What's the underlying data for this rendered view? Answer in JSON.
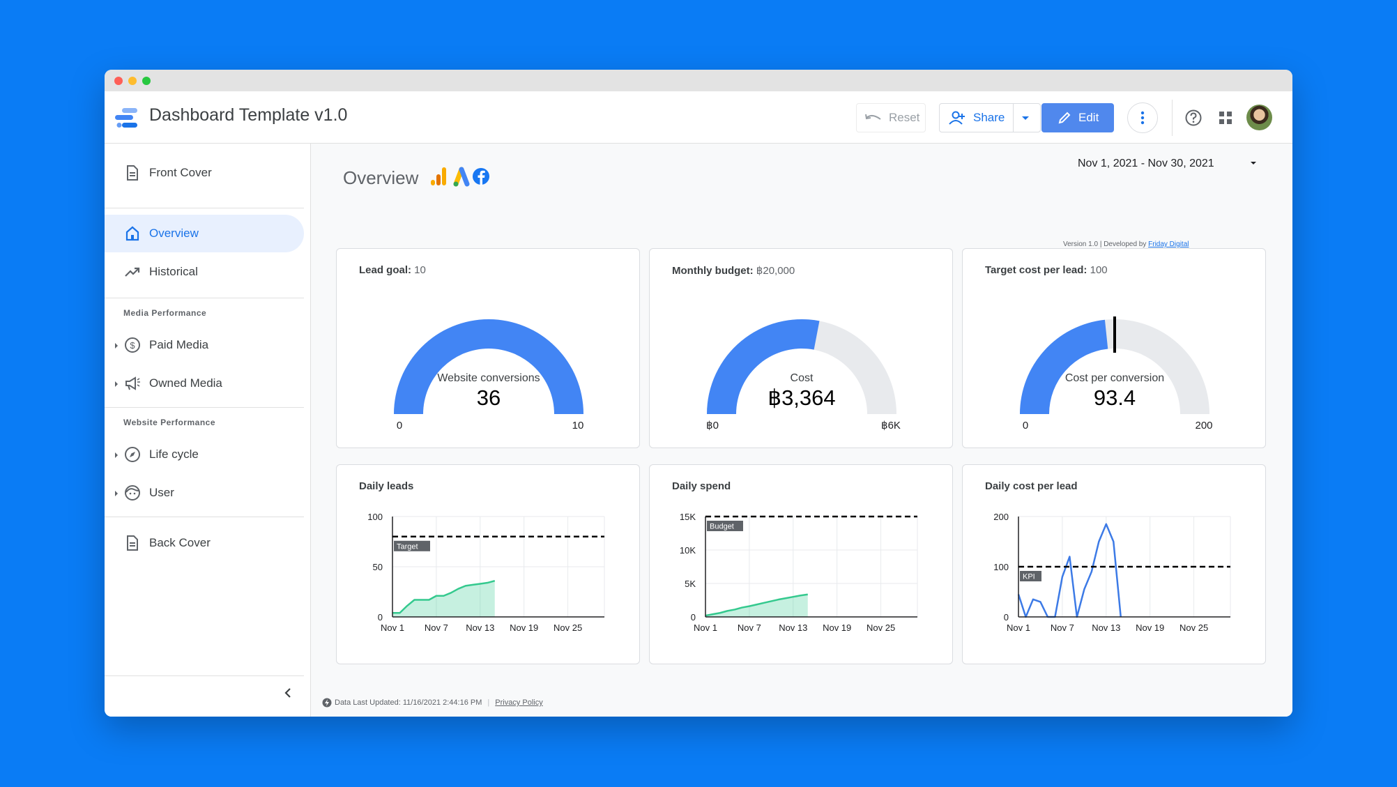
{
  "app": {
    "title": "Dashboard Template v1.0"
  },
  "toolbar": {
    "reset_label": "Reset",
    "share_label": "Share",
    "edit_label": "Edit"
  },
  "sidebar": {
    "front_cover": "Front Cover",
    "overview": "Overview",
    "historical": "Historical",
    "media_section": "Media Performance",
    "paid_media": "Paid Media",
    "owned_media": "Owned Media",
    "website_section": "Website Performance",
    "life_cycle": "Life cycle",
    "user": "User",
    "back_cover": "Back Cover"
  },
  "page": {
    "title": "Overview",
    "date_range": "Nov 1, 2021 - Nov 30, 2021",
    "version_text": "Version 1.0 | Developed by ",
    "version_link": "Friday Digital",
    "footer_updated": "Data Last Updated: 11/16/2021 2:44:16 PM",
    "footer_separator": "|",
    "footer_privacy": "Privacy Policy"
  },
  "gauges": [
    {
      "title_bold": "Lead goal:",
      "title_value": "10",
      "label": "Website conversions",
      "value": "36",
      "min_label": "0",
      "max_label": "10",
      "fill_fraction": 1.0,
      "target_fraction": null
    },
    {
      "title_bold": "Monthly budget:",
      "title_value": "฿20,000",
      "label": "Cost",
      "value": "฿3,364",
      "min_label": "฿0",
      "max_label": "฿6K",
      "fill_fraction": 0.56,
      "target_fraction": null
    },
    {
      "title_bold": "Target cost per lead:",
      "title_value": "100",
      "label": "Cost per conversion",
      "value": "93.4",
      "min_label": "0",
      "max_label": "200",
      "fill_fraction": 0.467,
      "target_fraction": 0.5
    }
  ],
  "chart_data": [
    {
      "type": "area",
      "title": "Daily leads",
      "ylim": [
        0,
        100
      ],
      "yticks": [
        "0",
        "50",
        "100"
      ],
      "xticks": [
        "Nov 1",
        "Nov 7",
        "Nov 13",
        "Nov 19",
        "Nov 25"
      ],
      "xtick_days": [
        1,
        7,
        13,
        19,
        25
      ],
      "xlim": [
        1,
        30
      ],
      "reference_line": {
        "label": "Target",
        "value": 80
      },
      "x": [
        1,
        2,
        3,
        4,
        5,
        6,
        7,
        8,
        9,
        10,
        11,
        12,
        13,
        14,
        15
      ],
      "values": [
        4,
        4,
        11,
        17,
        17,
        17,
        21,
        21,
        24,
        28,
        31,
        32,
        33,
        34,
        36
      ],
      "color": "#34c98e"
    },
    {
      "type": "area",
      "title": "Daily spend",
      "ylim": [
        0,
        15000
      ],
      "yticks": [
        "0",
        "5K",
        "10K",
        "15K"
      ],
      "xticks": [
        "Nov 1",
        "Nov 7",
        "Nov 13",
        "Nov 19",
        "Nov 25"
      ],
      "xtick_days": [
        1,
        7,
        13,
        19,
        25
      ],
      "xlim": [
        1,
        30
      ],
      "reference_line": {
        "label": "Budget",
        "value": 15000
      },
      "x": [
        1,
        2,
        3,
        4,
        5,
        6,
        7,
        8,
        9,
        10,
        11,
        12,
        13,
        14,
        15
      ],
      "values": [
        200,
        400,
        600,
        900,
        1100,
        1400,
        1600,
        1850,
        2100,
        2350,
        2600,
        2800,
        3000,
        3200,
        3364
      ],
      "color": "#34c98e"
    },
    {
      "type": "line",
      "title": "Daily cost per lead",
      "ylim": [
        0,
        200
      ],
      "yticks": [
        "0",
        "100",
        "200"
      ],
      "xticks": [
        "Nov 1",
        "Nov 7",
        "Nov 13",
        "Nov 19",
        "Nov 25"
      ],
      "xtick_days": [
        1,
        7,
        13,
        19,
        25
      ],
      "xlim": [
        1,
        30
      ],
      "reference_line": {
        "label": "KPI",
        "value": 100
      },
      "x": [
        1,
        2,
        3,
        4,
        5,
        6,
        7,
        8,
        9,
        10,
        11,
        12,
        13,
        14,
        15
      ],
      "values": [
        45,
        0,
        35,
        30,
        0,
        0,
        80,
        120,
        0,
        55,
        90,
        150,
        185,
        150,
        0
      ],
      "color": "#3c7ae6"
    }
  ],
  "colors": {
    "background": "#0a7cf5",
    "accent": "#1a73e8",
    "gauge_fill": "#4285f4",
    "gauge_track": "#e8eaed"
  }
}
